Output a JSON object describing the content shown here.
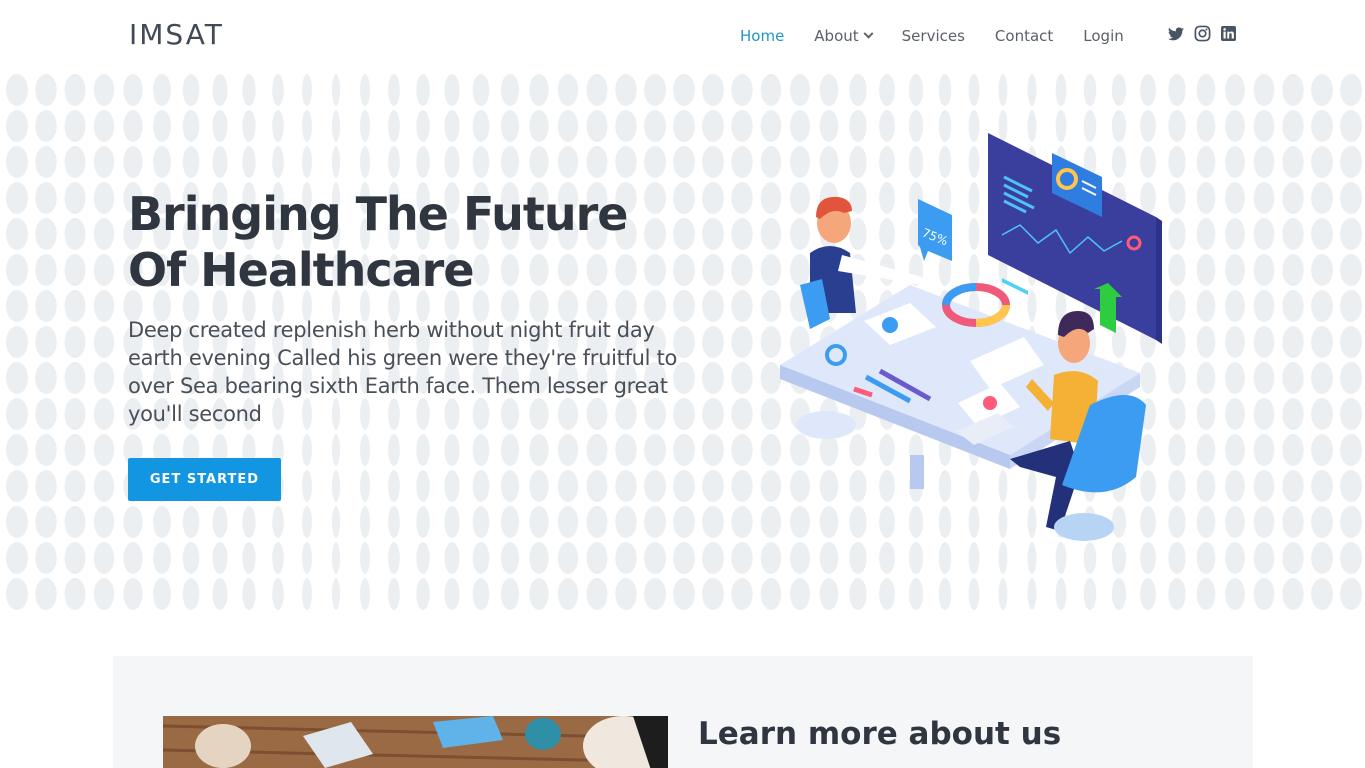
{
  "header": {
    "logo": "IMSAT",
    "nav": [
      {
        "label": "Home",
        "active": true
      },
      {
        "label": "About",
        "dropdown": true
      },
      {
        "label": "Services"
      },
      {
        "label": "Contact"
      },
      {
        "label": "Login"
      }
    ],
    "social": [
      "twitter-icon",
      "instagram-icon",
      "linkedin-icon"
    ]
  },
  "hero": {
    "title": "Bringing The Future Of Healthcare",
    "text": "Deep created replenish herb without night fruit day earth evening Called his green were they're fruitful to over Sea bearing sixth Earth face. Them lesser great you'll second",
    "cta_label": "GET STARTED",
    "illustration_badge": "75%"
  },
  "about": {
    "title": "Learn more about us"
  },
  "colors": {
    "accent": "#1396e1",
    "nav_active": "#2196c9",
    "heading": "#2f3640",
    "section_bg": "#f5f6f8"
  }
}
